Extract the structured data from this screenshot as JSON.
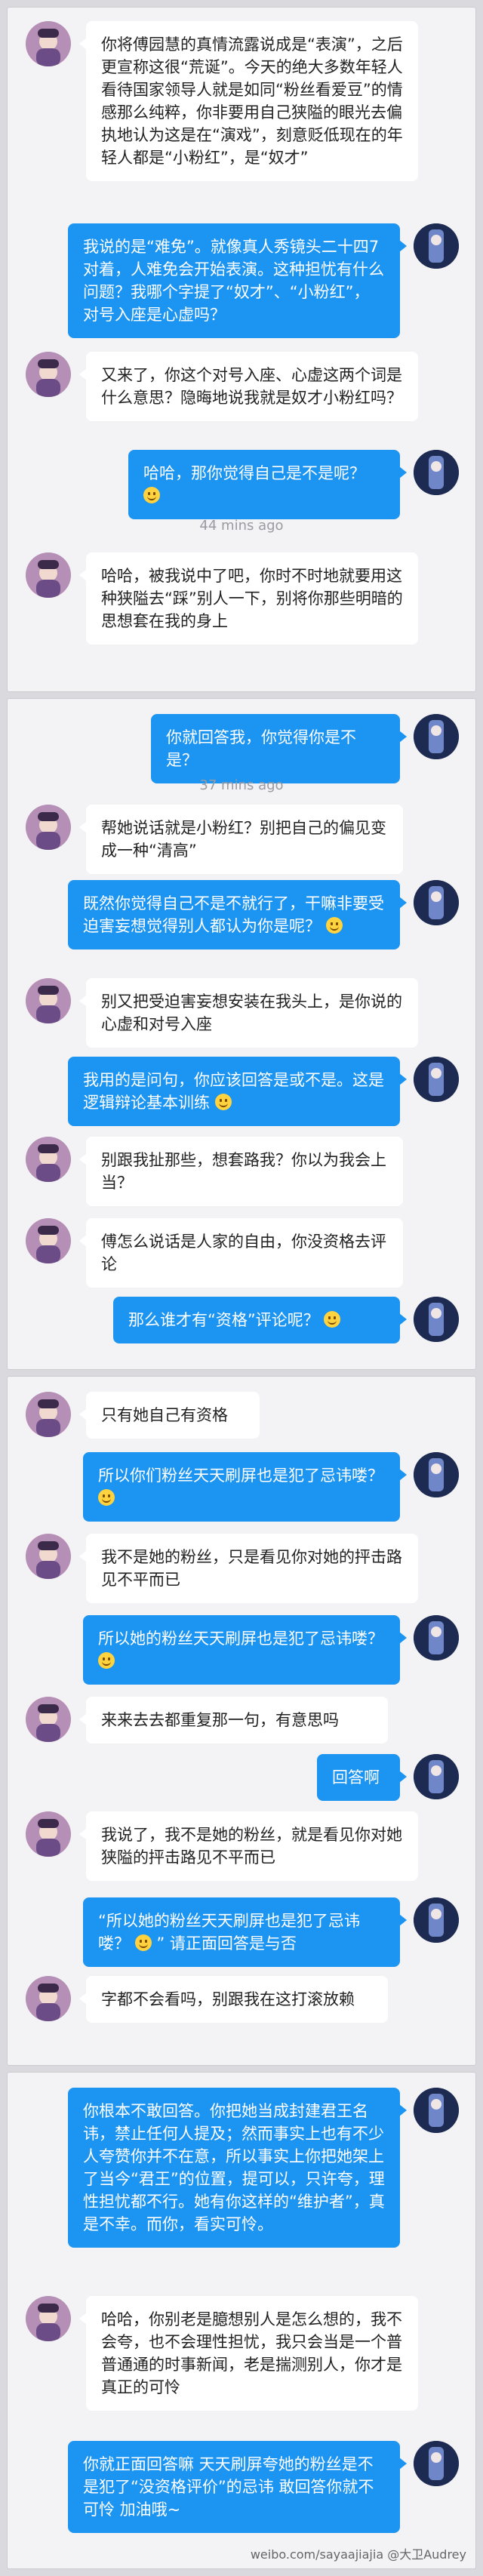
{
  "panels": [
    {
      "messages": [
        {
          "type": "in",
          "text": "你将傅园慧的真情流露说成是“表演”，之后更宣称这很“荒诞”。今天的绝大多数年轻人看待国家领导人就是如同“粉丝看爱豆”的情感那么纯粹，你非要用自己狭隘的眼光去偏执地认为这是在“演戏”，刻意贬低现在的年轻人都是“小粉红”，是“奴才”"
        },
        {
          "type": "out",
          "text": "我说的是“难免”。就像真人秀镜头二十四7对着，人难免会开始表演。这种担忧有什么问题？我哪个字提了“奴才”、“小粉红”，对号入座是心虚吗？"
        },
        {
          "type": "in",
          "text": "又来了，你这个对号入座、心虚这两个词是什么意思？隐晦地说我就是奴才小粉红吗？"
        },
        {
          "type": "out",
          "text": "哈哈，那你觉得自己是不是呢？",
          "emoji": true
        },
        {
          "type": "time",
          "text": "44 mins ago"
        },
        {
          "type": "in",
          "text": "哈哈，被我说中了吧，你时不时地就要用这种狭隘去“踩”别人一下，别将你那些明暗的思想套在我的身上"
        }
      ]
    },
    {
      "messages": [
        {
          "type": "out",
          "text": "你就回答我，你觉得你是不是？"
        },
        {
          "type": "time",
          "text": "37 mins ago"
        },
        {
          "type": "in",
          "text": "帮她说话就是小粉红？别把自己的偏见变成一种“清高”"
        },
        {
          "type": "out",
          "text": "既然你觉得自己不是不就行了，干嘛非要受迫害妄想觉得别人都认为你是呢？",
          "emoji": true
        },
        {
          "type": "in",
          "text": "别又把受迫害妄想安装在我头上，是你说的心虚和对号入座"
        },
        {
          "type": "out",
          "text": "我用的是问句，你应该回答是或不是。这是逻辑辩论基本训练",
          "emoji": true
        },
        {
          "type": "in",
          "text": "别跟我扯那些，想套路我？你以为我会上当？"
        },
        {
          "type": "in",
          "text": "傅怎么说话是人家的自由，你没资格去评论"
        },
        {
          "type": "out",
          "text": "那么谁才有“资格”评论呢？",
          "emoji": true
        }
      ]
    },
    {
      "messages": [
        {
          "type": "in",
          "text": "只有她自己有资格"
        },
        {
          "type": "out",
          "text": "所以你们粉丝天天刷屏也是犯了忌讳喽？",
          "emoji": true
        },
        {
          "type": "in",
          "text": "我不是她的粉丝，只是看见你对她的抨击路见不平而已"
        },
        {
          "type": "out",
          "text": "所以她的粉丝天天刷屏也是犯了忌讳喽？",
          "emoji": true
        },
        {
          "type": "in",
          "text": "来来去去都重复那一句，有意思吗"
        },
        {
          "type": "out",
          "text": "回答啊"
        },
        {
          "type": "in",
          "text": "我说了，我不是她的粉丝，就是看见你对她狭隘的抨击路见不平而已"
        },
        {
          "type": "out",
          "text": "“所以她的粉丝天天刷屏也是犯了忌讳喽？",
          "text2": "” 请正面回答是与否",
          "emoji": true
        },
        {
          "type": "in",
          "text": "字都不会看吗，别跟我在这打滚放赖"
        }
      ]
    },
    {
      "messages": [
        {
          "type": "out",
          "text": "你根本不敢回答。你把她当成封建君王名讳，禁止任何人提及；然而事实上也有不少人夸赞你并不在意，所以事实上你把她架上了当今“君王”的位置，提可以，只许夸，理性担忧都不行。她有你这样的“维护者”，真是不幸。而你，看实可怜。"
        },
        {
          "type": "in",
          "text": "哈哈，你别老是臆想别人是怎么想的，我不会夸，也不会理性担忧，我只会当是一个普普通通的时事新闻，老是揣测别人，你才是真正的可怜"
        },
        {
          "type": "out",
          "text": "你就正面回答嘛 天天刷屏夸她的粉丝是不是犯了“没资格评价”的忌讳 敢回答你就不可怜 加油哦~"
        }
      ]
    }
  ],
  "watermark": "weibo.com/sayaajiajia  @大卫Audrey"
}
